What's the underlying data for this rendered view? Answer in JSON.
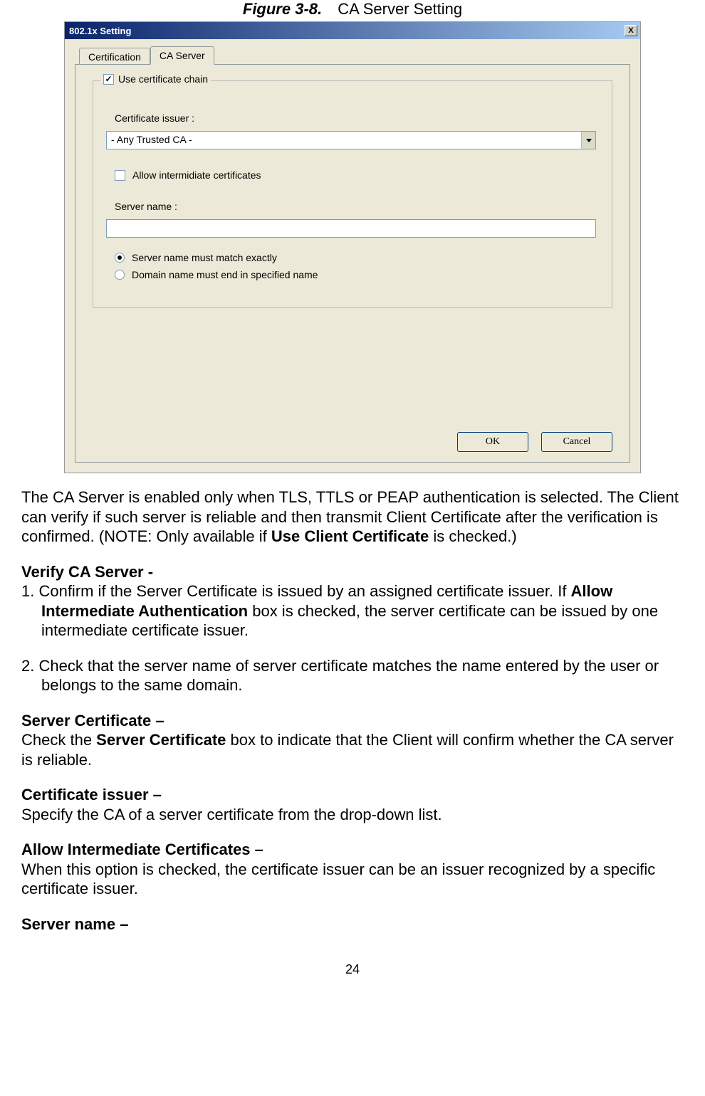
{
  "figure": {
    "number": "Figure 3-8.",
    "title": "CA Server Setting"
  },
  "dialog": {
    "title": "802.1x Setting",
    "close": "X",
    "tabs": {
      "certification": "Certification",
      "ca_server": "CA Server"
    },
    "group_legend": "Use certificate chain",
    "cert_issuer_label": "Certificate issuer :",
    "cert_issuer_value": "- Any Trusted CA -",
    "allow_intermediate": "Allow intermidiate certificates",
    "server_name_label": "Server name :",
    "server_name_value": "",
    "radio_exact": "Server name must match exactly",
    "radio_domain": "Domain name must end in specified name",
    "ok": "OK",
    "cancel": "Cancel"
  },
  "doc": {
    "intro_1": "The CA Server is enabled only when TLS, TTLS or PEAP authentication is selected. The Client can verify if such server is reliable and then transmit Client Certificate after the verification is confirmed. (NOTE: Only available if ",
    "intro_bold": "Use Client Certificate",
    "intro_2": " is checked.)",
    "verify_heading": "Verify CA Server -",
    "step1_a": "1. Confirm if the Server Certificate is issued by an assigned certificate issuer. If ",
    "step1_bold": "Allow Intermediate Authentication",
    "step1_b": " box is checked, the server certificate can be issued by one intermediate certificate issuer.",
    "step2": "2. Check that the server name of server certificate matches the name entered by the user or belongs to the same domain.",
    "server_cert_heading": "Server Certificate –",
    "server_cert_a": "Check the ",
    "server_cert_bold": "Server Certificate",
    "server_cert_b": " box to indicate that the Client will confirm whether the CA server is reliable.",
    "cert_issuer_heading": "Certificate issuer –",
    "cert_issuer_body": "Specify the CA of a server certificate from the drop-down list.",
    "allow_heading": "Allow Intermediate Certificates –",
    "allow_body": "When this option is checked, the certificate issuer can be an issuer recognized by a specific certificate issuer.",
    "server_name_heading": "Server name –",
    "page": "24"
  }
}
